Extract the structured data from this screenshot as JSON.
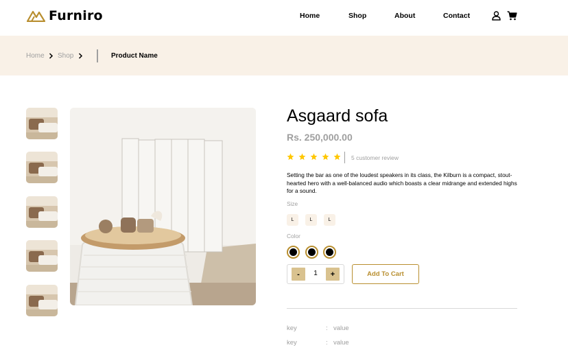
{
  "header": {
    "brand": "Furniro",
    "nav": [
      "Home",
      "Shop",
      "About",
      "Contact"
    ],
    "icons": [
      "user-icon",
      "cart-icon"
    ],
    "accent": "#b88e2f"
  },
  "breadcrumb": {
    "items": [
      "Home",
      "Shop"
    ],
    "current": "Product Name",
    "background": "#f9f1e7"
  },
  "gallery": {
    "thumbnail_count": 5
  },
  "product": {
    "title": "Asgaard sofa",
    "price": "Rs. 250,000.00",
    "rating": 5,
    "rating_max": 5,
    "review_text": "5 customer review",
    "description": "Setting the bar as one of the loudest speakers in its class, the Kilburn is a compact, stout-hearted hero with a well-balanced audio which boasts a clear midrange and extended highs for a sound.",
    "size_label": "Size",
    "sizes": [
      "L",
      "L",
      "L"
    ],
    "color_label": "Color",
    "colors": [
      "#000000",
      "#000000",
      "#000000"
    ],
    "quantity": "1",
    "minus_label": "-",
    "plus_label": "+",
    "add_to_cart": "Add To Cart",
    "specs": [
      {
        "key": "key",
        "sep": ":",
        "value": "value"
      },
      {
        "key": "key",
        "sep": ":",
        "value": "value"
      }
    ]
  }
}
